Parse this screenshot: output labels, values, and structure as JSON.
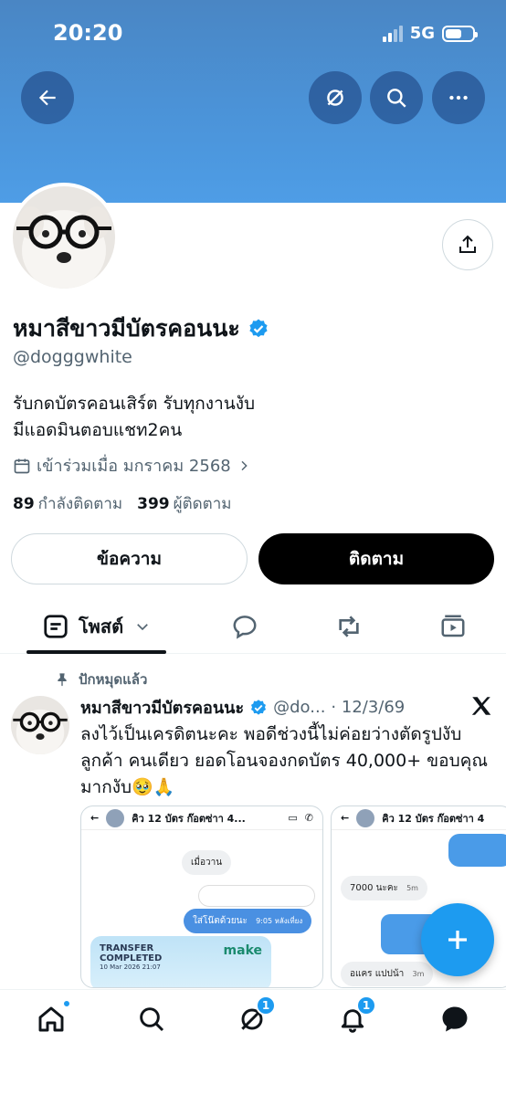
{
  "status_bar": {
    "time": "20:20",
    "network": "5G"
  },
  "profile": {
    "display_name": "หมาสีขาวมีบัตรคอนนะ",
    "handle": "@dogggwhite",
    "bio_line1": "รับกดบัตรคอนเสิร์ต รับทุกงานงับ",
    "bio_line2": "มีแอดมินตอบแชท2คน",
    "joined": "เข้าร่วมเมื่อ มกราคม 2568",
    "following_count": "89",
    "following_label": "กำลังติดตาม",
    "followers_count": "399",
    "followers_label": "ผู้ติดตาม",
    "message_button": "ข้อความ",
    "follow_button": "ติดตาม"
  },
  "tabs": {
    "posts_label": "โพสต์"
  },
  "pinned_post": {
    "pinned_label": "ปักหมุดแล้ว",
    "author_name": "หมาสีขาวมีบัตรคอนนะ",
    "author_handle": "@do...",
    "date": "· 12/3/69",
    "text": "ลงไว้เป็นเครดิตนะคะ พอดีช่วงนี้ไม่ค่อยว่างตัดรูปงับ ลูกค้า คนเดียว ยอดโอนจองกดบัตร 40,000+ ขอบคุณมากงับ🥹🙏",
    "media1": {
      "chat_title": "คิว 12 บัตร ก๊อตซ่าา 4...",
      "bubble_yesterday": "เมื่อวาน",
      "bubble_reply": "ใส่โน๊ตด้วยนะ",
      "bubble_reply_time": "9:05 หลังเที่ยง",
      "transfer_title": "TRANSFER",
      "transfer_sub": "COMPLETED",
      "transfer_date": "10 Mar 2026 21:07",
      "brand": "make"
    },
    "media2": {
      "chat_title": "คิว 12 บัตร ก๊อตซ่าา 4",
      "bubble_price": "7000 นะคะ",
      "bubble_price_time": "5m",
      "bubble_other": "อแคร แปปน้า",
      "bubble_other_time": "3m"
    }
  },
  "nav": {
    "notifications_badge": "1",
    "grok_badge": "1"
  },
  "colors": {
    "accent": "#1d9bf0",
    "banner": "#4b93d8"
  }
}
